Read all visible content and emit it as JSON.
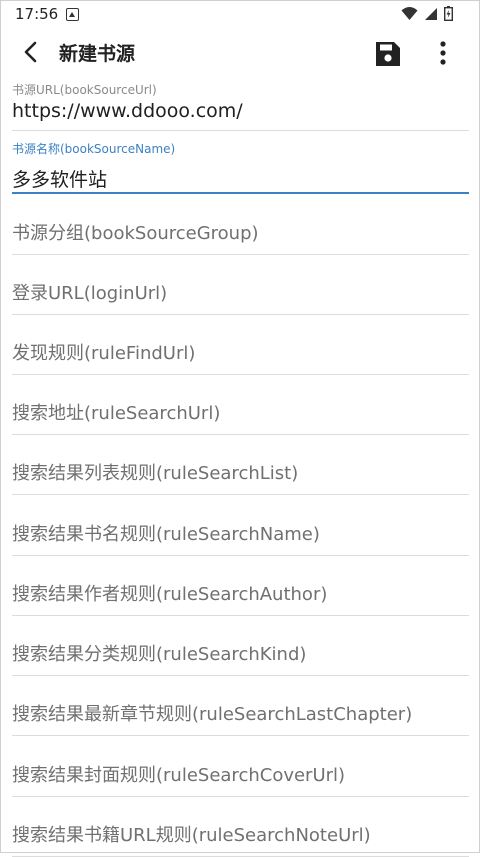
{
  "status": {
    "time": "17:56"
  },
  "app_bar": {
    "title": "新建书源"
  },
  "fields": [
    {
      "label": "书源URL(bookSourceUrl)",
      "value": "https://www.ddooo.com/"
    },
    {
      "label": "书源名称(bookSourceName)",
      "value": "多多软件站"
    }
  ],
  "placeholders": [
    "书源分组(bookSourceGroup)",
    "登录URL(loginUrl)",
    "发现规则(ruleFindUrl)",
    "搜索地址(ruleSearchUrl)",
    "搜索结果列表规则(ruleSearchList)",
    "搜索结果书名规则(ruleSearchName)",
    "搜索结果作者规则(ruleSearchAuthor)",
    "搜索结果分类规则(ruleSearchKind)",
    "搜索结果最新章节规则(ruleSearchLastChapter)",
    "搜索结果封面规则(ruleSearchCoverUrl)",
    "搜索结果书籍URL规则(ruleSearchNoteUrl)"
  ],
  "colors": {
    "accent": "#3b82c4",
    "hint": "#707070",
    "divider": "#dcdcdc"
  },
  "icons": [
    "notification-icon",
    "wifi-icon",
    "signal-icon",
    "battery-icon",
    "back-arrow-icon",
    "save-icon",
    "more-vert-icon"
  ]
}
